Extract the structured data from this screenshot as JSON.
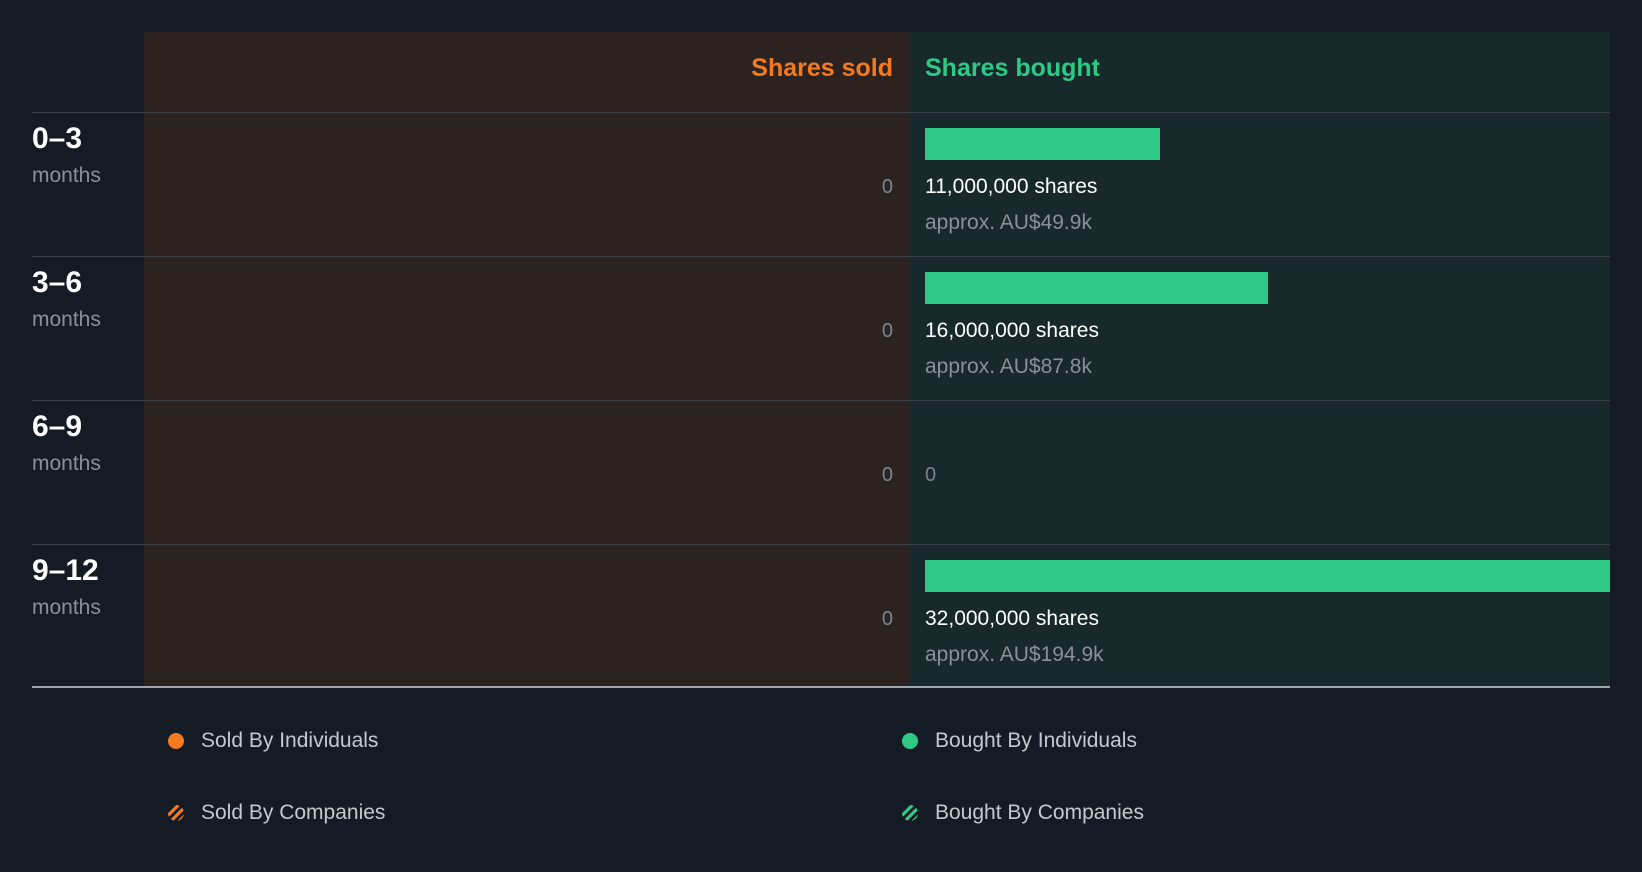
{
  "header": {
    "sold_label": "Shares sold",
    "bought_label": "Shares bought"
  },
  "colors": {
    "sold": "#f47a20",
    "bought": "#2dc985"
  },
  "chart_data": {
    "type": "bar",
    "categories": [
      "0–3 months",
      "3–6 months",
      "6–9 months",
      "9–12 months"
    ],
    "series": [
      {
        "name": "Shares sold",
        "values": [
          0,
          0,
          0,
          0
        ]
      },
      {
        "name": "Shares bought",
        "values": [
          11000000,
          16000000,
          0,
          32000000
        ]
      }
    ],
    "xlim": [
      0,
      32000000
    ],
    "rows": [
      {
        "period": "0–3",
        "unit": "months",
        "sold_text": "0",
        "bought": 11000000,
        "bought_text": "11,000,000 shares",
        "approx_text": "approx. AU$49.9k"
      },
      {
        "period": "3–6",
        "unit": "months",
        "sold_text": "0",
        "bought": 16000000,
        "bought_text": "16,000,000 shares",
        "approx_text": "approx. AU$87.8k"
      },
      {
        "period": "6–9",
        "unit": "months",
        "sold_text": "0",
        "bought": 0,
        "bought_text": "0",
        "approx_text": ""
      },
      {
        "period": "9–12",
        "unit": "months",
        "sold_text": "0",
        "bought": 32000000,
        "bought_text": "32,000,000 shares",
        "approx_text": "approx. AU$194.9k"
      }
    ]
  },
  "legend": [
    {
      "label": "Sold By Individuals",
      "kind": "dot",
      "color": "#f47a20"
    },
    {
      "label": "Bought By Individuals",
      "kind": "dot",
      "color": "#2dc985"
    },
    {
      "label": "Sold By Companies",
      "kind": "stripe",
      "color": "#f47a20"
    },
    {
      "label": "Bought By Companies",
      "kind": "stripe",
      "color": "#2dc985"
    }
  ]
}
